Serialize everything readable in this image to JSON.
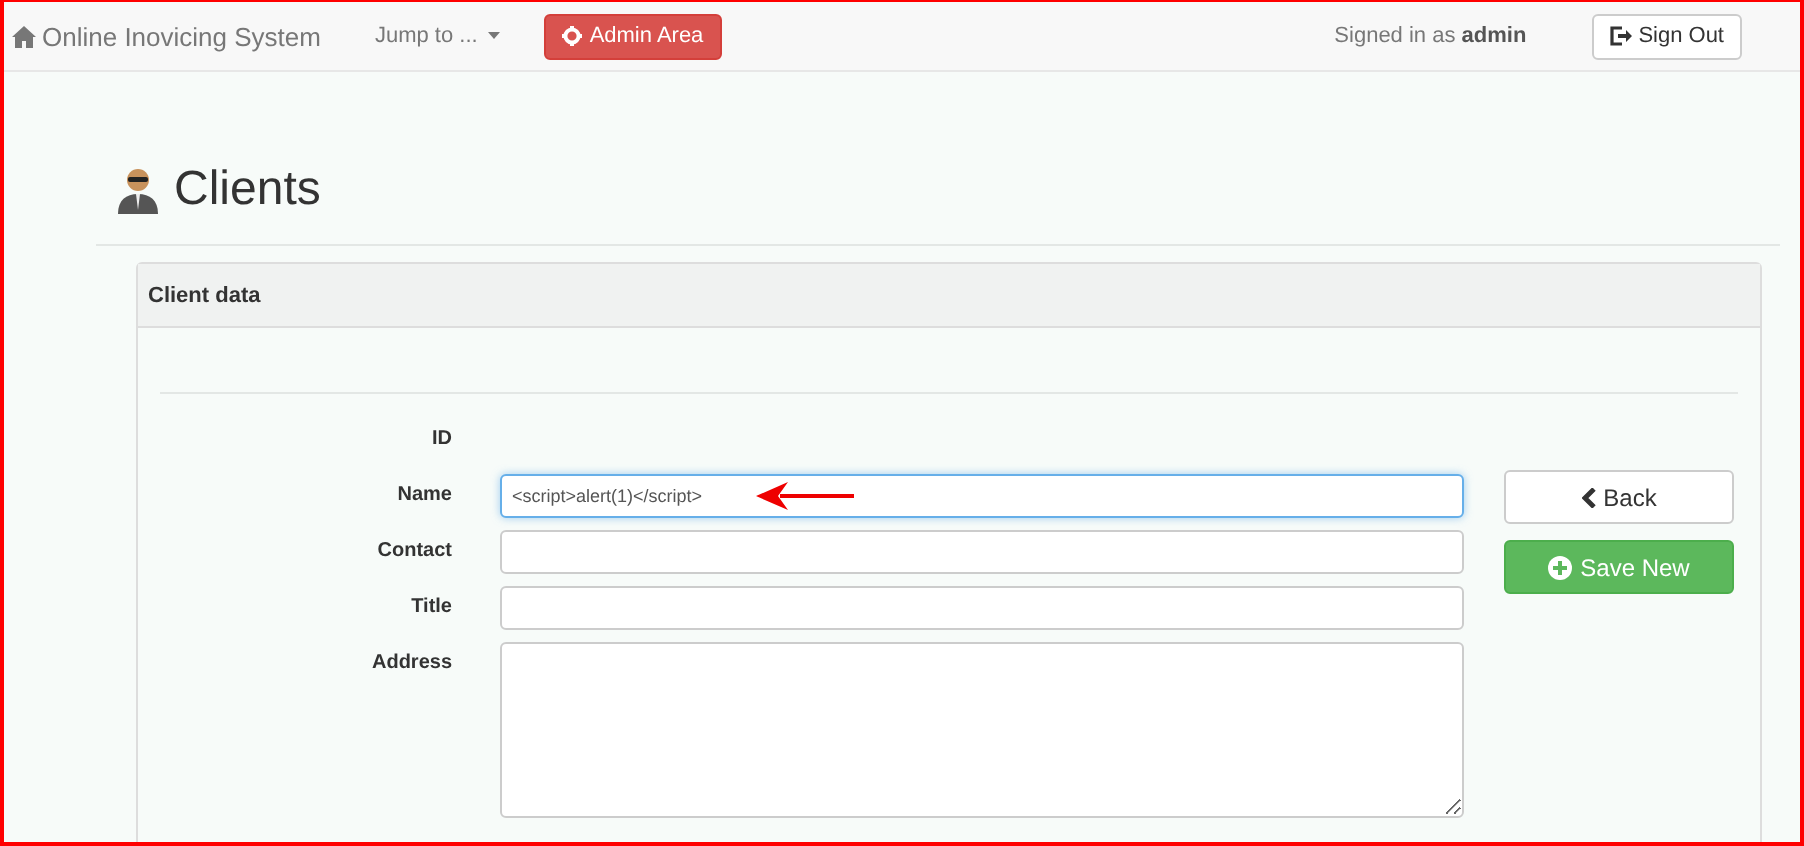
{
  "navbar": {
    "brand": "Online Inovicing System",
    "jump_menu": "Jump to ...",
    "admin_button": "Admin Area",
    "signed_in_prefix": "Signed in as",
    "signed_in_user": "admin",
    "sign_out": "Sign Out"
  },
  "page_title": "Clients",
  "panel": {
    "title": "Client data",
    "fields": [
      {
        "label": "ID",
        "kind": "static"
      },
      {
        "label": "Name",
        "kind": "text",
        "value": "<script>alert(1)</script>",
        "focused": true,
        "annotated": true
      },
      {
        "label": "Contact",
        "kind": "text",
        "focused": false,
        "annotated": false
      },
      {
        "label": "Title",
        "kind": "text",
        "focused": false,
        "annotated": false
      },
      {
        "label": "Address",
        "kind": "textarea",
        "focused": false,
        "annotated": false
      }
    ],
    "buttons": [
      {
        "label": "Back",
        "kind": "default"
      },
      {
        "label": "Save New",
        "kind": "success"
      }
    ]
  }
}
